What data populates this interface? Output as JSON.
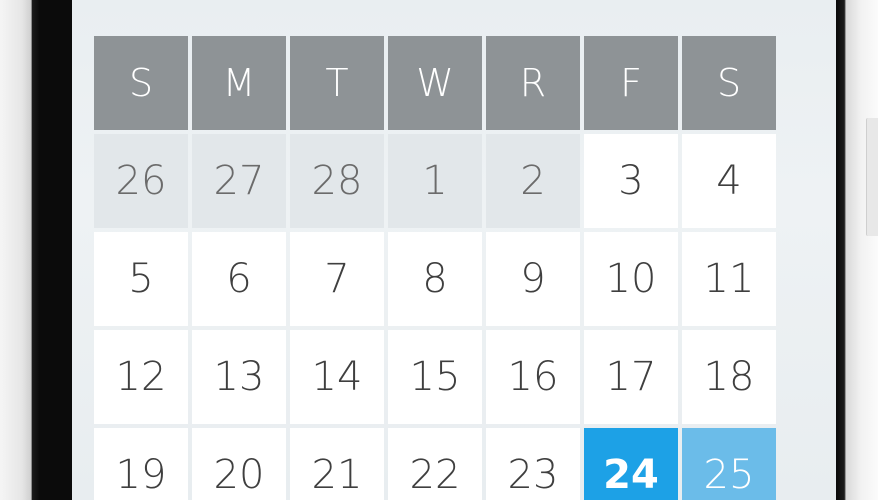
{
  "calendar": {
    "weekdays": [
      "S",
      "M",
      "T",
      "W",
      "R",
      "F",
      "S"
    ],
    "weeks": [
      [
        {
          "day": "26",
          "state": "muted"
        },
        {
          "day": "27",
          "state": "muted"
        },
        {
          "day": "28",
          "state": "muted"
        },
        {
          "day": "1",
          "state": "muted"
        },
        {
          "day": "2",
          "state": "muted"
        },
        {
          "day": "3",
          "state": "normal"
        },
        {
          "day": "4",
          "state": "normal"
        }
      ],
      [
        {
          "day": "5",
          "state": "normal"
        },
        {
          "day": "6",
          "state": "normal"
        },
        {
          "day": "7",
          "state": "normal"
        },
        {
          "day": "8",
          "state": "normal"
        },
        {
          "day": "9",
          "state": "normal"
        },
        {
          "day": "10",
          "state": "normal"
        },
        {
          "day": "11",
          "state": "normal"
        }
      ],
      [
        {
          "day": "12",
          "state": "normal"
        },
        {
          "day": "13",
          "state": "normal"
        },
        {
          "day": "14",
          "state": "normal"
        },
        {
          "day": "15",
          "state": "normal"
        },
        {
          "day": "16",
          "state": "normal"
        },
        {
          "day": "17",
          "state": "normal"
        },
        {
          "day": "18",
          "state": "normal"
        }
      ],
      [
        {
          "day": "19",
          "state": "normal"
        },
        {
          "day": "20",
          "state": "normal"
        },
        {
          "day": "21",
          "state": "normal"
        },
        {
          "day": "22",
          "state": "normal"
        },
        {
          "day": "23",
          "state": "normal"
        },
        {
          "day": "24",
          "state": "today"
        },
        {
          "day": "25",
          "state": "selected"
        }
      ]
    ]
  },
  "colors": {
    "header_bg": "#8e9396",
    "today_bg": "#1da1e6",
    "selected_bg": "#6bbce9",
    "muted_bg": "#e2e7ea"
  }
}
